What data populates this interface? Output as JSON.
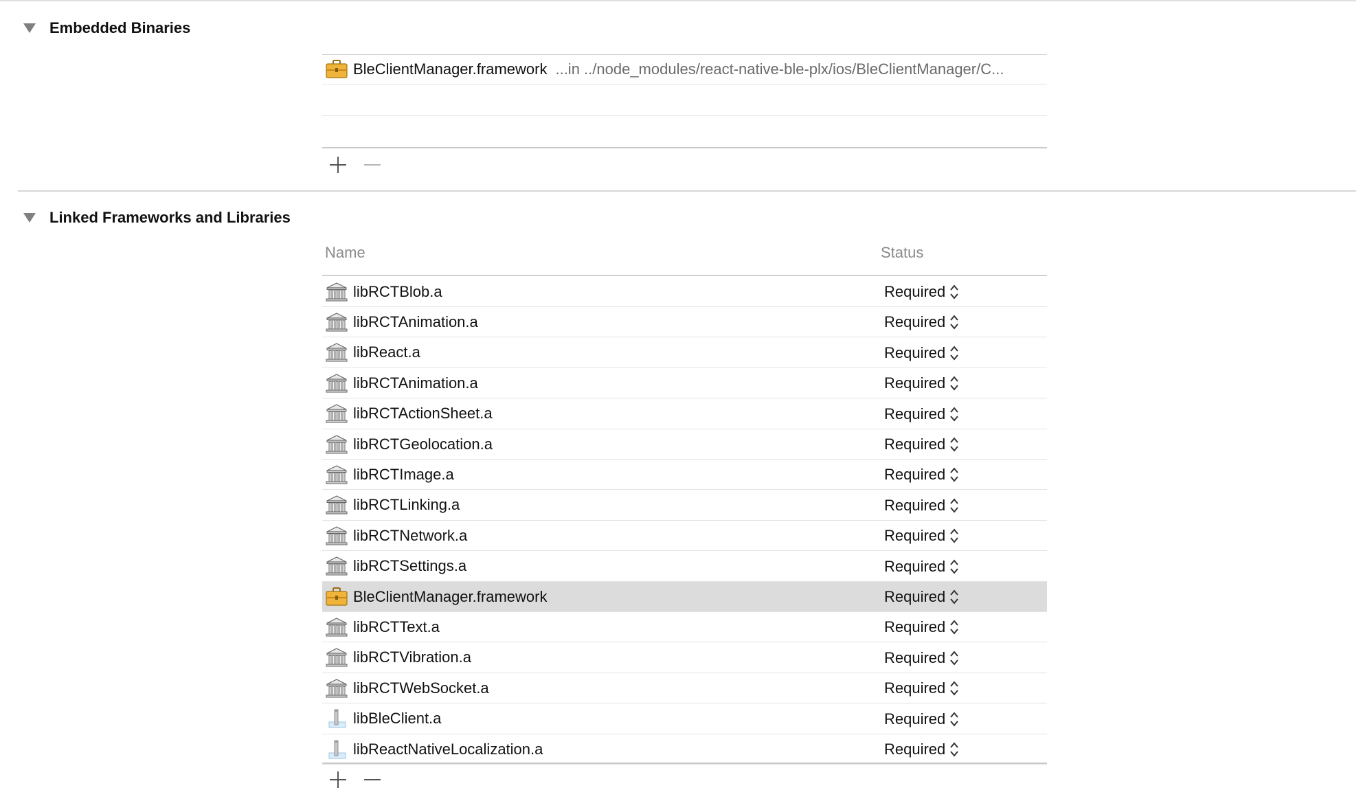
{
  "embedded": {
    "title": "Embedded Binaries",
    "items": [
      {
        "name": "BleClientManager.framework",
        "path": "...in ../node_modules/react-native-ble-plx/ios/BleClientManager/C...",
        "icon": "framework-icon"
      }
    ]
  },
  "linked": {
    "title": "Linked Frameworks and Libraries",
    "columns": {
      "name": "Name",
      "status": "Status"
    },
    "rows": [
      {
        "name": "libRCTBlob.a",
        "status": "Required",
        "icon": "library-icon"
      },
      {
        "name": "libRCTAnimation.a",
        "status": "Required",
        "icon": "library-icon"
      },
      {
        "name": "libReact.a",
        "status": "Required",
        "icon": "library-icon"
      },
      {
        "name": "libRCTAnimation.a",
        "status": "Required",
        "icon": "library-icon"
      },
      {
        "name": "libRCTActionSheet.a",
        "status": "Required",
        "icon": "library-icon"
      },
      {
        "name": "libRCTGeolocation.a",
        "status": "Required",
        "icon": "library-icon"
      },
      {
        "name": "libRCTImage.a",
        "status": "Required",
        "icon": "library-icon"
      },
      {
        "name": "libRCTLinking.a",
        "status": "Required",
        "icon": "library-icon"
      },
      {
        "name": "libRCTNetwork.a",
        "status": "Required",
        "icon": "library-icon"
      },
      {
        "name": "libRCTSettings.a",
        "status": "Required",
        "icon": "library-icon"
      },
      {
        "name": "BleClientManager.framework",
        "status": "Required",
        "icon": "framework-icon",
        "selected": true
      },
      {
        "name": "libRCTText.a",
        "status": "Required",
        "icon": "library-icon"
      },
      {
        "name": "libRCTVibration.a",
        "status": "Required",
        "icon": "library-icon"
      },
      {
        "name": "libRCTWebSocket.a",
        "status": "Required",
        "icon": "library-icon"
      },
      {
        "name": "libBleClient.a",
        "status": "Required",
        "icon": "static-lib-icon"
      },
      {
        "name": "libReactNativeLocalization.a",
        "status": "Required",
        "icon": "static-lib-icon"
      }
    ]
  }
}
